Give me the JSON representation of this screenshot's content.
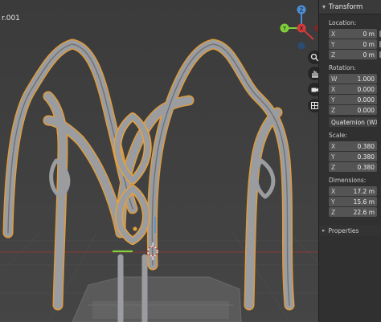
{
  "viewport": {
    "object_name": "r.001",
    "nav_icons": [
      "zoom-icon",
      "pan-hand-icon",
      "camera-icon",
      "grid-icon"
    ],
    "gizmo_axes": {
      "x": "X",
      "y": "Y",
      "z": "Z"
    },
    "colors": {
      "background": "#3d3d3d",
      "model": "#9a9c9f",
      "outline": "#e9a13b"
    }
  },
  "npanel": {
    "header": "Transform",
    "location": {
      "label": "Location:",
      "x": {
        "axis": "X",
        "value": "0 m"
      },
      "y": {
        "axis": "Y",
        "value": "0 m"
      },
      "z": {
        "axis": "Z",
        "value": "0 m"
      }
    },
    "rotation": {
      "label": "Rotation:",
      "w": {
        "axis": "W",
        "value": "1.000"
      },
      "x": {
        "axis": "X",
        "value": "0.000"
      },
      "y": {
        "axis": "Y",
        "value": "0.000"
      },
      "z": {
        "axis": "Z",
        "value": "0.000"
      },
      "mode": "Quaternion (WXYZ)"
    },
    "scale": {
      "label": "Scale:",
      "x": {
        "axis": "X",
        "value": "0.380"
      },
      "y": {
        "axis": "Y",
        "value": "0.380"
      },
      "z": {
        "axis": "Z",
        "value": "0.380"
      }
    },
    "dimensions": {
      "label": "Dimensions:",
      "x": {
        "axis": "X",
        "value": "17.2 m"
      },
      "y": {
        "axis": "Y",
        "value": "15.6 m"
      },
      "z": {
        "axis": "Z",
        "value": "22.6 m"
      }
    },
    "properties": "Properties"
  }
}
